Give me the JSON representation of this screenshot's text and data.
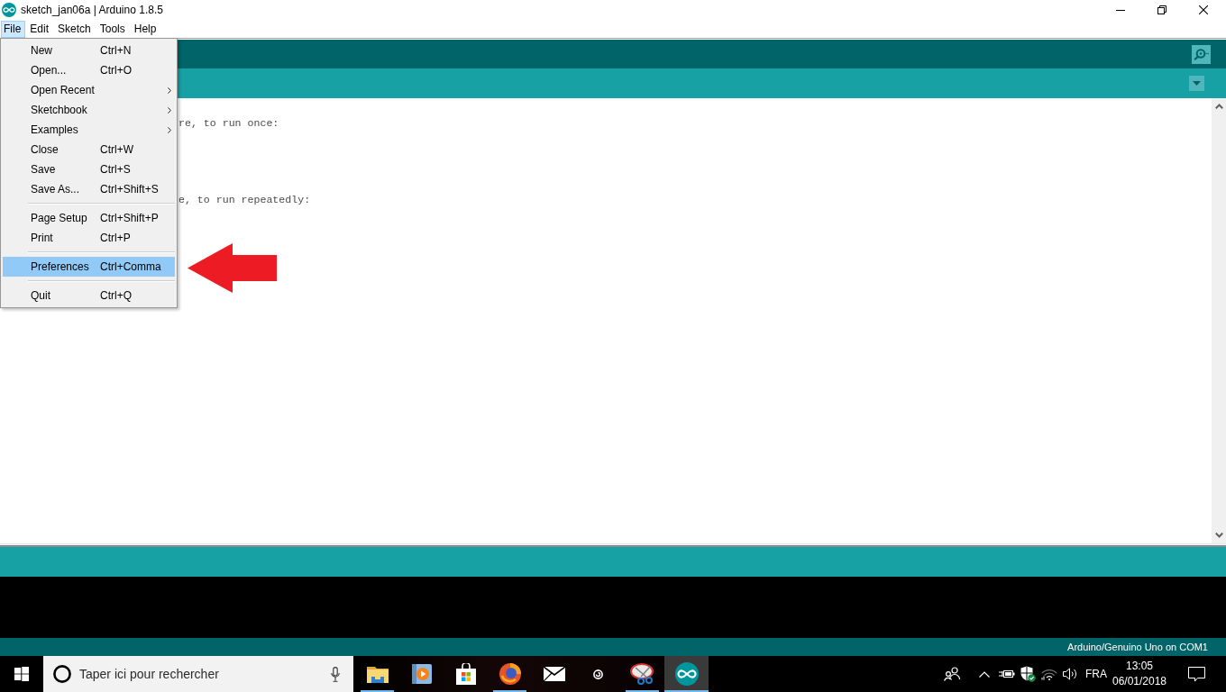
{
  "window": {
    "title": "sketch_jan06a | Arduino 1.8.5"
  },
  "menu_bar": [
    {
      "label": "File",
      "selected": true
    },
    {
      "label": "Edit",
      "selected": false
    },
    {
      "label": "Sketch",
      "selected": false
    },
    {
      "label": "Tools",
      "selected": false
    },
    {
      "label": "Help",
      "selected": false
    }
  ],
  "file_menu": [
    {
      "kind": "item",
      "label": "New",
      "shortcut": "Ctrl+N",
      "submenu": false,
      "selected": false
    },
    {
      "kind": "item",
      "label": "Open...",
      "shortcut": "Ctrl+O",
      "submenu": false,
      "selected": false
    },
    {
      "kind": "item",
      "label": "Open Recent",
      "submenu": true,
      "selected": false
    },
    {
      "kind": "item",
      "label": "Sketchbook",
      "submenu": true,
      "selected": false
    },
    {
      "kind": "item",
      "label": "Examples",
      "submenu": true,
      "selected": false
    },
    {
      "kind": "item",
      "label": "Close",
      "shortcut": "Ctrl+W",
      "submenu": false,
      "selected": false
    },
    {
      "kind": "item",
      "label": "Save",
      "shortcut": "Ctrl+S",
      "submenu": false,
      "selected": false
    },
    {
      "kind": "item",
      "label": "Save As...",
      "shortcut": "Ctrl+Shift+S",
      "submenu": false,
      "selected": false
    },
    {
      "kind": "separator"
    },
    {
      "kind": "item",
      "label": "Page Setup",
      "shortcut": "Ctrl+Shift+P",
      "submenu": false,
      "selected": false
    },
    {
      "kind": "item",
      "label": "Print",
      "shortcut": "Ctrl+P",
      "submenu": false,
      "selected": false
    },
    {
      "kind": "separator"
    },
    {
      "kind": "item",
      "label": "Preferences",
      "shortcut": "Ctrl+Comma",
      "submenu": false,
      "selected": true
    },
    {
      "kind": "separator"
    },
    {
      "kind": "item",
      "label": "Quit",
      "shortcut": "Ctrl+Q",
      "submenu": false,
      "selected": false
    }
  ],
  "editor": {
    "code_lines": [
      "re, to run once:",
      "e, to run repeatedly:"
    ]
  },
  "status_bar": {
    "text": "Arduino/Genuino Uno on COM1"
  },
  "taskbar": {
    "search": {
      "placeholder": "Taper ici pour rechercher"
    },
    "apps": [
      {
        "kind": "folder",
        "running": true,
        "active": false
      },
      {
        "kind": "media",
        "running": false,
        "active": false
      },
      {
        "kind": "store",
        "running": false,
        "active": false
      },
      {
        "kind": "browser",
        "running": true,
        "active": false
      },
      {
        "kind": "mail",
        "running": false,
        "active": false
      },
      {
        "kind": "spiral",
        "running": false,
        "active": false
      },
      {
        "kind": "paint",
        "running": true,
        "active": false
      },
      {
        "kind": "arduino",
        "running": true,
        "active": true
      }
    ],
    "tray": {
      "language": "FRA",
      "time": "13:05",
      "date": "06/01/2018"
    }
  }
}
